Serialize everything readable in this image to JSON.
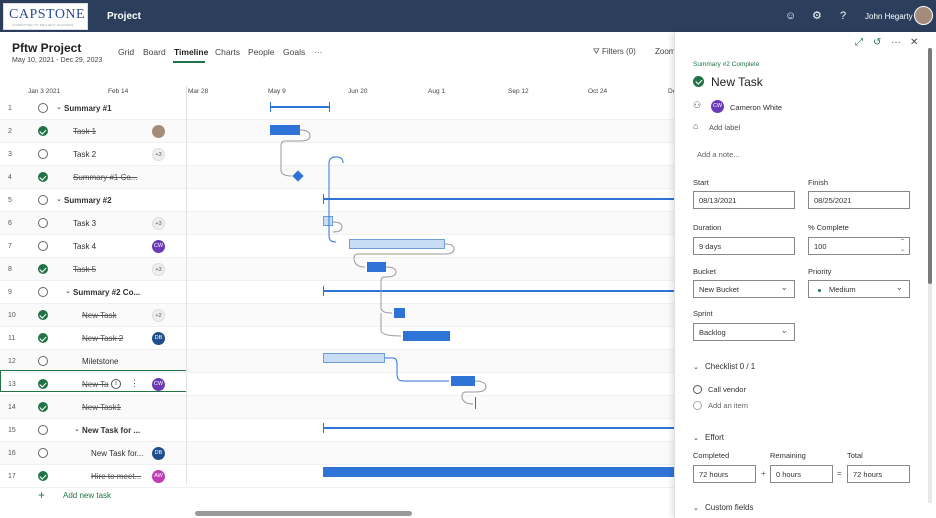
{
  "app": {
    "logo_text": "CAPSTONE",
    "logo_sub": "COMMITTED TO PROJECT SUCCESS",
    "title": "Project",
    "user_name": "John Hegarty"
  },
  "project": {
    "name": "Pftw Project",
    "dates": "May 10, 2021 - Dec 29, 2023"
  },
  "nav": {
    "tabs": [
      "Grid",
      "Board",
      "Timeline",
      "Charts",
      "People",
      "Goals"
    ],
    "active": "Timeline",
    "more": "···",
    "filters": "Filters (0)",
    "zoom": "Zoom"
  },
  "timeline": {
    "dates": [
      "Jan 3 2021",
      "Feb 14",
      "Mar 28",
      "May 9",
      "Jun 20",
      "Aug 1",
      "Sep 12",
      "Oct 24",
      "De"
    ]
  },
  "tasks": [
    {
      "n": "1",
      "name": "Summary #1",
      "done": false
    },
    {
      "n": "2",
      "name": "Task 1",
      "done": true
    },
    {
      "n": "3",
      "name": "Task 2",
      "done": false,
      "badge": "+3"
    },
    {
      "n": "4",
      "name": "Summary #1 Co...",
      "done": true
    },
    {
      "n": "5",
      "name": "Summary #2",
      "done": false
    },
    {
      "n": "6",
      "name": "Task 3",
      "done": false,
      "badge": "+3"
    },
    {
      "n": "7",
      "name": "Task 4",
      "done": false,
      "badge": "CW"
    },
    {
      "n": "8",
      "name": "Task 5",
      "done": true,
      "badge": "+3"
    },
    {
      "n": "9",
      "name": "Summary #2 Co...",
      "done": false
    },
    {
      "n": "10",
      "name": "New Task",
      "done": true,
      "badge": "+2"
    },
    {
      "n": "11",
      "name": "New Task 2",
      "done": true,
      "badge": "DB"
    },
    {
      "n": "12",
      "name": "Miletstone",
      "done": false
    },
    {
      "n": "13",
      "name": "New Ta",
      "done": true,
      "badge": "CW"
    },
    {
      "n": "14",
      "name": "New Task1",
      "done": true
    },
    {
      "n": "15",
      "name": "New Task for ...",
      "done": false
    },
    {
      "n": "16",
      "name": "New Task for...",
      "done": false,
      "badge": "DB"
    },
    {
      "n": "17",
      "name": "Hire to meet...",
      "done": true,
      "badge": "AW"
    }
  ],
  "add_task": "Add new task",
  "panel": {
    "breadcrumb": "Summary #2 Complete",
    "title": "New Task",
    "assignee_initials": "CW",
    "assignee": "Cameron White",
    "add_label": "Add label",
    "note_placeholder": "Add a note...",
    "start_label": "Start",
    "start": "08/13/2021",
    "finish_label": "Finish",
    "finish": "08/25/2021",
    "duration_label": "Duration",
    "duration": "9 days",
    "complete_label": "% Complete",
    "complete": "100",
    "bucket_label": "Bucket",
    "bucket": "New Bucket",
    "priority_label": "Priority",
    "priority": "Medium",
    "sprint_label": "Sprint",
    "sprint": "Backlog",
    "checklist_label": "Checklist 0 / 1",
    "checklist_item": "Call vendor",
    "add_item": "Add an item",
    "effort_label": "Effort",
    "completed_label": "Completed",
    "completed": "72 hours",
    "remaining_label": "Remaining",
    "remaining": "0 hours",
    "total_label": "Total",
    "total": "72 hours",
    "plus": "+",
    "equals": "=",
    "custom_fields": "Custom fields"
  },
  "colors": {
    "topbar": "#2b3f5c",
    "accent": "#217346",
    "bar": "#2e74d6"
  }
}
